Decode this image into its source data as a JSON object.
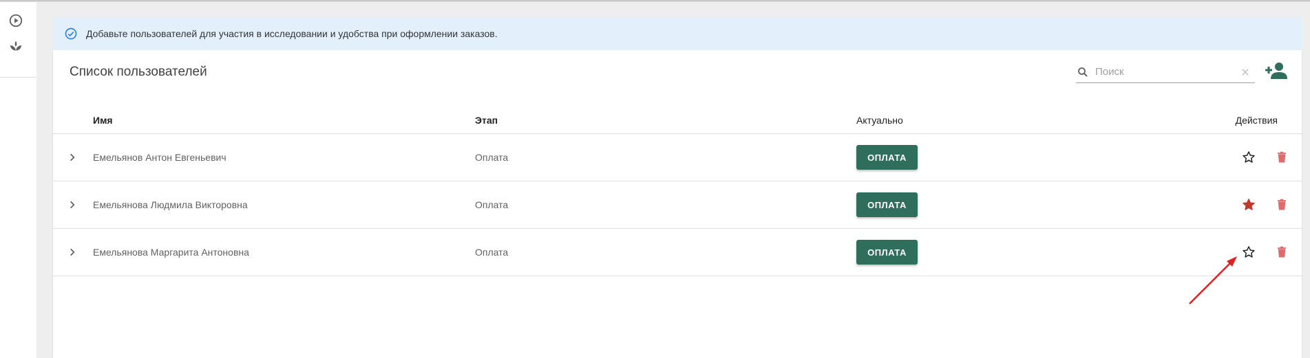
{
  "banner": {
    "text": "Добавьте пользователей для участия в исследовании и удобства при оформлении заказов."
  },
  "card": {
    "title": "Список пользователей"
  },
  "search": {
    "placeholder": "Поиск",
    "value": ""
  },
  "table": {
    "columns": [
      "Имя",
      "Этап",
      "Актуально",
      "Действия"
    ],
    "rows": [
      {
        "name": "Емельянов Антон Евгеньевич",
        "stage": "Оплата",
        "action_label": "ОПЛАТА",
        "favorite": false
      },
      {
        "name": "Емельянова Людмила Викторовна",
        "stage": "Оплата",
        "action_label": "ОПЛАТА",
        "favorite": true
      },
      {
        "name": "Емельянова Маргарита Антоновна",
        "stage": "Оплата",
        "action_label": "ОПЛАТА",
        "favorite": false
      }
    ]
  },
  "icons": {
    "rail": [
      "play-circle-icon",
      "plant-icon"
    ],
    "banner": "check-circle-icon",
    "search": "search-icon",
    "clear": "close-icon",
    "add": "add-user-icon",
    "expand": "chevron-right-icon",
    "favorite": "star-icon",
    "delete": "trash-icon"
  },
  "colors": {
    "accent": "#2e6e5a",
    "favorite_active": "#c0392b",
    "delete": "#e06b6b",
    "banner_bg": "#e3f0fb",
    "annotation_arrow": "#e02020"
  }
}
